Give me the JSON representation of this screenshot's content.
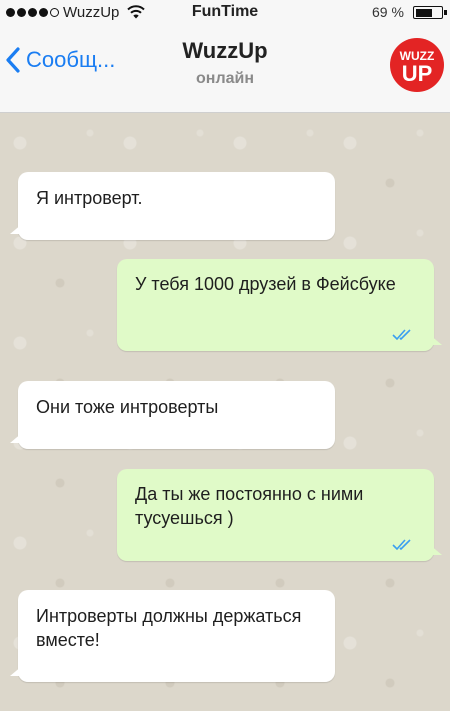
{
  "status_bar": {
    "carrier": "WuzzUp",
    "time": "FunTime",
    "battery_percent": "69 %",
    "battery_level": 0.69
  },
  "nav": {
    "back_label": "Сообщ...",
    "contact_name": "WuzzUp",
    "contact_status": "онлайн",
    "logo_text_top": "WUZZ",
    "logo_text_bottom": "UP"
  },
  "messages": [
    {
      "direction": "incoming",
      "text": "Я интроверт."
    },
    {
      "direction": "outgoing",
      "text": "У тебя 1000 друзей в Фейсбуке",
      "status": "read"
    },
    {
      "direction": "incoming",
      "text": "Они тоже интроверты"
    },
    {
      "direction": "outgoing",
      "text": "Да ты же постоянно с ними тусуешься )",
      "status": "read"
    },
    {
      "direction": "incoming",
      "text": "Интроверты должны держаться вместе!"
    }
  ],
  "colors": {
    "accent": "#1a7df2",
    "outgoing_bubble": "#e0fac8",
    "incoming_bubble": "#ffffff",
    "chat_background": "#dcd7cb",
    "read_ticks": "#3b9ff0",
    "logo_red": "#e32424"
  }
}
